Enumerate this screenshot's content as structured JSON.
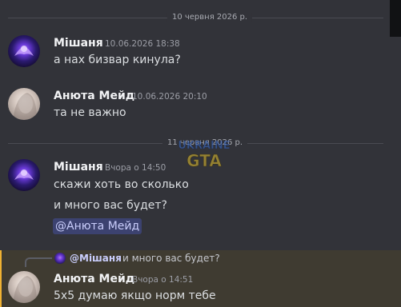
{
  "dividers": [
    {
      "label": "10 червня 2026 р."
    },
    {
      "label": "11 червня 2026 р."
    }
  ],
  "messages": [
    {
      "author": "Мішаня",
      "timestamp": "10.06.2026 18:38",
      "lines": [
        "а нах бизвар кинула?"
      ]
    },
    {
      "author": "Анюта Мейд",
      "timestamp": "10.06.2026 20:10",
      "lines": [
        "та не важно"
      ]
    },
    {
      "author": "Мішаня",
      "timestamp": "Вчора о 14:50",
      "lines": [
        "скажи хоть во сколько",
        "и много вас будет?"
      ],
      "mention": "@Анюта Мейд"
    },
    {
      "author": "Анюта Мейд",
      "timestamp": "Вчора о 14:51",
      "lines": [
        "5х5 думаю якщо норм тебе"
      ],
      "reply": {
        "author": "@Мішаня",
        "text": "и много вас будет?"
      }
    }
  ],
  "watermark": {
    "text_top": "UKRAINE",
    "text_bottom": "GTA"
  },
  "colors": {
    "background": "#323339",
    "mention_bg": "#3c4270",
    "highlight_bg": "#3f3b31",
    "highlight_bar": "#f0b232"
  }
}
